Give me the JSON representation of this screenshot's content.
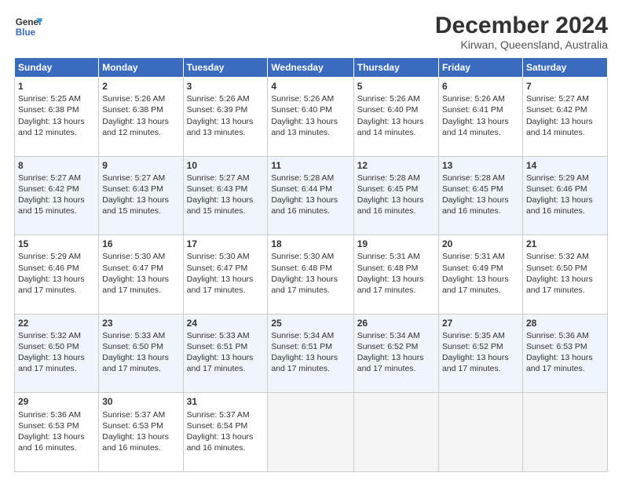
{
  "logo": {
    "line1": "General",
    "line2": "Blue"
  },
  "title": "December 2024",
  "subtitle": "Kirwan, Queensland, Australia",
  "days_of_week": [
    "Sunday",
    "Monday",
    "Tuesday",
    "Wednesday",
    "Thursday",
    "Friday",
    "Saturday"
  ],
  "weeks": [
    [
      {
        "day": "1",
        "info": "Sunrise: 5:25 AM\nSunset: 6:38 PM\nDaylight: 13 hours\nand 12 minutes."
      },
      {
        "day": "2",
        "info": "Sunrise: 5:26 AM\nSunset: 6:38 PM\nDaylight: 13 hours\nand 12 minutes."
      },
      {
        "day": "3",
        "info": "Sunrise: 5:26 AM\nSunset: 6:39 PM\nDaylight: 13 hours\nand 13 minutes."
      },
      {
        "day": "4",
        "info": "Sunrise: 5:26 AM\nSunset: 6:40 PM\nDaylight: 13 hours\nand 13 minutes."
      },
      {
        "day": "5",
        "info": "Sunrise: 5:26 AM\nSunset: 6:40 PM\nDaylight: 13 hours\nand 14 minutes."
      },
      {
        "day": "6",
        "info": "Sunrise: 5:26 AM\nSunset: 6:41 PM\nDaylight: 13 hours\nand 14 minutes."
      },
      {
        "day": "7",
        "info": "Sunrise: 5:27 AM\nSunset: 6:42 PM\nDaylight: 13 hours\nand 14 minutes."
      }
    ],
    [
      {
        "day": "8",
        "info": "Sunrise: 5:27 AM\nSunset: 6:42 PM\nDaylight: 13 hours\nand 15 minutes."
      },
      {
        "day": "9",
        "info": "Sunrise: 5:27 AM\nSunset: 6:43 PM\nDaylight: 13 hours\nand 15 minutes."
      },
      {
        "day": "10",
        "info": "Sunrise: 5:27 AM\nSunset: 6:43 PM\nDaylight: 13 hours\nand 15 minutes."
      },
      {
        "day": "11",
        "info": "Sunrise: 5:28 AM\nSunset: 6:44 PM\nDaylight: 13 hours\nand 16 minutes."
      },
      {
        "day": "12",
        "info": "Sunrise: 5:28 AM\nSunset: 6:45 PM\nDaylight: 13 hours\nand 16 minutes."
      },
      {
        "day": "13",
        "info": "Sunrise: 5:28 AM\nSunset: 6:45 PM\nDaylight: 13 hours\nand 16 minutes."
      },
      {
        "day": "14",
        "info": "Sunrise: 5:29 AM\nSunset: 6:46 PM\nDaylight: 13 hours\nand 16 minutes."
      }
    ],
    [
      {
        "day": "15",
        "info": "Sunrise: 5:29 AM\nSunset: 6:46 PM\nDaylight: 13 hours\nand 17 minutes."
      },
      {
        "day": "16",
        "info": "Sunrise: 5:30 AM\nSunset: 6:47 PM\nDaylight: 13 hours\nand 17 minutes."
      },
      {
        "day": "17",
        "info": "Sunrise: 5:30 AM\nSunset: 6:47 PM\nDaylight: 13 hours\nand 17 minutes."
      },
      {
        "day": "18",
        "info": "Sunrise: 5:30 AM\nSunset: 6:48 PM\nDaylight: 13 hours\nand 17 minutes."
      },
      {
        "day": "19",
        "info": "Sunrise: 5:31 AM\nSunset: 6:48 PM\nDaylight: 13 hours\nand 17 minutes."
      },
      {
        "day": "20",
        "info": "Sunrise: 5:31 AM\nSunset: 6:49 PM\nDaylight: 13 hours\nand 17 minutes."
      },
      {
        "day": "21",
        "info": "Sunrise: 5:32 AM\nSunset: 6:50 PM\nDaylight: 13 hours\nand 17 minutes."
      }
    ],
    [
      {
        "day": "22",
        "info": "Sunrise: 5:32 AM\nSunset: 6:50 PM\nDaylight: 13 hours\nand 17 minutes."
      },
      {
        "day": "23",
        "info": "Sunrise: 5:33 AM\nSunset: 6:50 PM\nDaylight: 13 hours\nand 17 minutes."
      },
      {
        "day": "24",
        "info": "Sunrise: 5:33 AM\nSunset: 6:51 PM\nDaylight: 13 hours\nand 17 minutes."
      },
      {
        "day": "25",
        "info": "Sunrise: 5:34 AM\nSunset: 6:51 PM\nDaylight: 13 hours\nand 17 minutes."
      },
      {
        "day": "26",
        "info": "Sunrise: 5:34 AM\nSunset: 6:52 PM\nDaylight: 13 hours\nand 17 minutes."
      },
      {
        "day": "27",
        "info": "Sunrise: 5:35 AM\nSunset: 6:52 PM\nDaylight: 13 hours\nand 17 minutes."
      },
      {
        "day": "28",
        "info": "Sunrise: 5:36 AM\nSunset: 6:53 PM\nDaylight: 13 hours\nand 17 minutes."
      }
    ],
    [
      {
        "day": "29",
        "info": "Sunrise: 5:36 AM\nSunset: 6:53 PM\nDaylight: 13 hours\nand 16 minutes."
      },
      {
        "day": "30",
        "info": "Sunrise: 5:37 AM\nSunset: 6:53 PM\nDaylight: 13 hours\nand 16 minutes."
      },
      {
        "day": "31",
        "info": "Sunrise: 5:37 AM\nSunset: 6:54 PM\nDaylight: 13 hours\nand 16 minutes."
      },
      null,
      null,
      null,
      null
    ]
  ]
}
